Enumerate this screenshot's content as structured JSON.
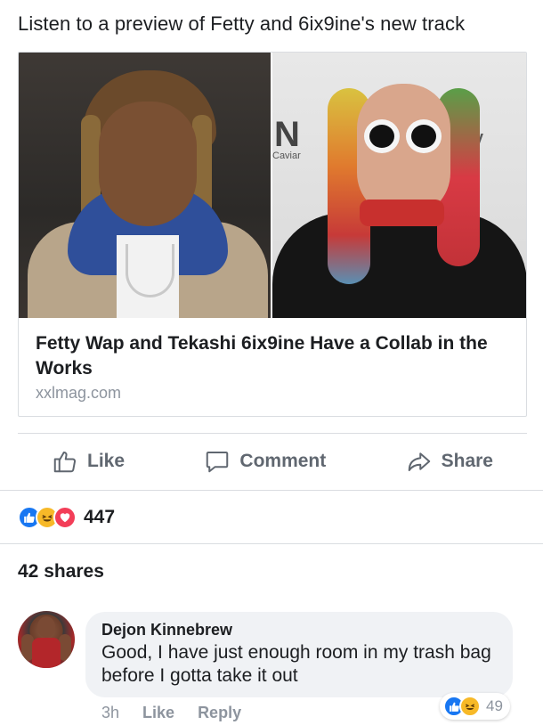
{
  "post": {
    "text": "Listen to a preview of Fetty and 6ix9ine's new track"
  },
  "link_card": {
    "image_left_alt": "",
    "image_right_overlay": {
      "logo_text": "N",
      "caviar_text": "Caviar",
      "tify_text": "tify"
    },
    "title": "Fetty Wap and Tekashi 6ix9ine Have a Collab in the Works",
    "domain": "xxlmag.com"
  },
  "actions": {
    "like_label": "Like",
    "comment_label": "Comment",
    "share_label": "Share"
  },
  "reactions": {
    "icons": [
      "like-icon",
      "haha-icon",
      "love-icon"
    ],
    "count": "447"
  },
  "shares": {
    "label": "42 shares"
  },
  "comment": {
    "author": "Dejon Kinnebrew",
    "text": "Good, I have just enough room in my trash bag before I gotta take it out",
    "time": "3h",
    "like_label": "Like",
    "reply_label": "Reply",
    "reaction_icons": [
      "like-icon",
      "haha-icon"
    ],
    "reaction_count": "49"
  },
  "colors": {
    "like_blue": "#1877f2",
    "haha_yellow": "#f7b928",
    "love_red": "#f33e58",
    "secondary_text": "#8d949e",
    "action_text": "#606770"
  }
}
